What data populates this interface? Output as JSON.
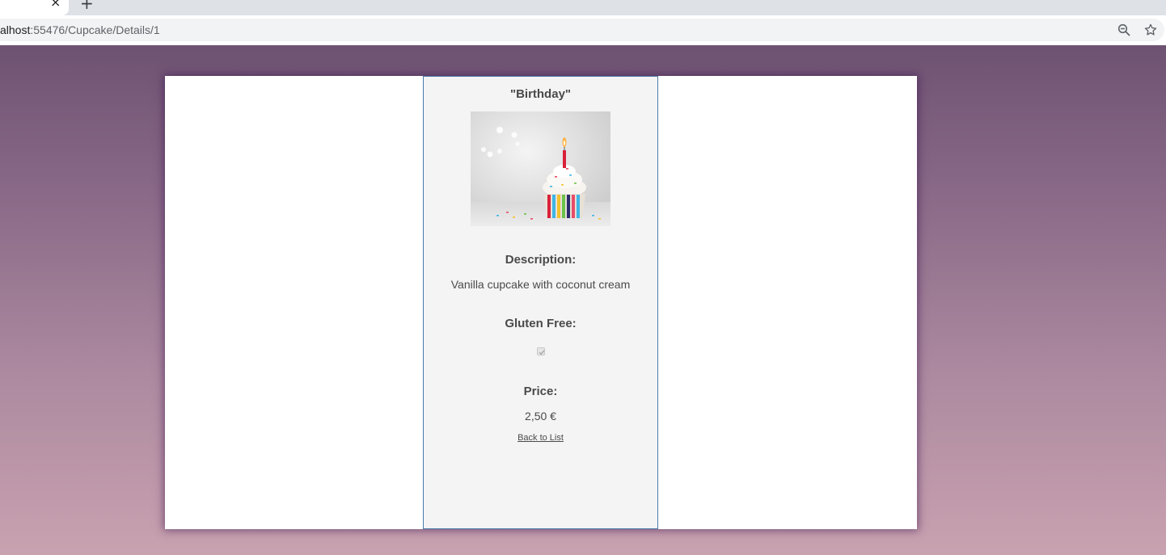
{
  "browser": {
    "tab_close_glyph": "×",
    "new_tab_glyph": "+",
    "url_host": "alhost",
    "url_path": ":55476/Cupcake/Details/1",
    "icons": [
      "zoom-out-icon",
      "bookmark-star-icon"
    ]
  },
  "page": {
    "background_top": "#6e5272",
    "background_bottom": "#c9a2b0",
    "panel_border": "#4a7aa8"
  },
  "cupcake": {
    "name": "\"Birthday\"",
    "image_alt": "cupcake with birthday candle",
    "description_label": "Description:",
    "description": "Vanilla cupcake with coconut cream",
    "gluten_free_label": "Gluten Free:",
    "gluten_free": true,
    "price_label": "Price:",
    "price": "2,50 €"
  },
  "links": {
    "back_to_list": "Back to List"
  }
}
